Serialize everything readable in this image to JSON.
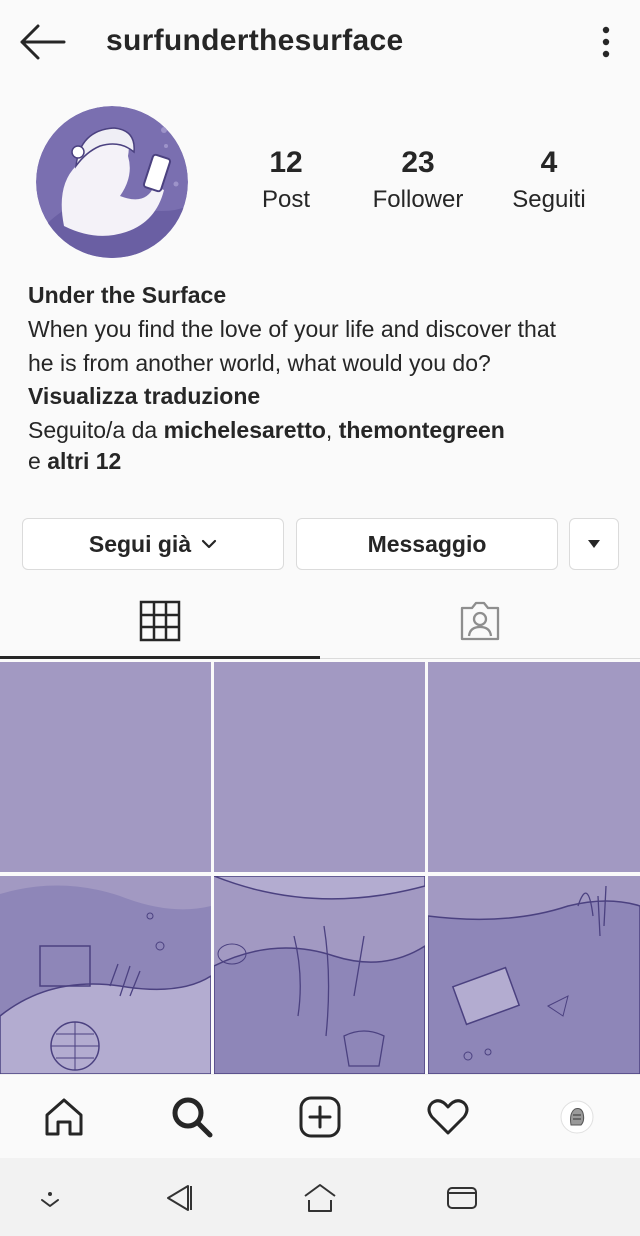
{
  "header": {
    "username": "surfunderthesurface",
    "back_icon": "arrow-left-icon",
    "menu_icon": "more-vertical-icon"
  },
  "profile": {
    "stats": [
      {
        "value": "12",
        "label": "Post"
      },
      {
        "value": "23",
        "label": "Follower"
      },
      {
        "value": "4",
        "label": "Seguiti"
      }
    ],
    "name": "Under the Surface",
    "bio_line1": "When you find the love of your life and discover that",
    "bio_line2": "he is from another world, what would you do?",
    "translate": "Visualizza traduzione",
    "followed_prefix": "Seguito/a da ",
    "followed_user1": "michelesaretto",
    "followed_sep": ", ",
    "followed_user2": "themontegreen",
    "followed_more_prefix": "e ",
    "followed_more": "altri 12"
  },
  "actions": {
    "follow_label": "Segui già",
    "message_label": "Messaggio"
  },
  "tabs": [
    {
      "icon": "grid-icon",
      "active": true
    },
    {
      "icon": "tagged-user-icon",
      "active": false
    }
  ],
  "colors": {
    "accent_purple": "#a299c2",
    "text": "#262626",
    "border": "#dbdbdb"
  },
  "bottom_nav": [
    "home-icon",
    "search-icon",
    "add-post-icon",
    "heart-icon",
    "profile-avatar-icon"
  ],
  "system_nav": [
    "notification-down-icon",
    "back-triangle-icon",
    "home-outline-icon",
    "recents-icon"
  ]
}
